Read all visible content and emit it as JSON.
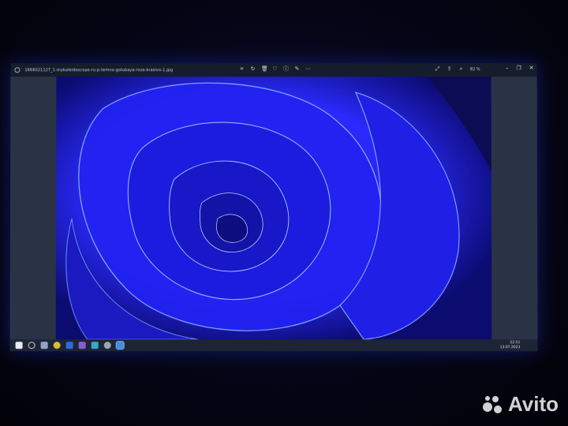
{
  "window": {
    "filename": "1666021127_1-mykaleidoscope-ru-p-temno-golubaya-roza-krasivo-1.jpg",
    "zoom": "82 %",
    "toolbar_icons": [
      "crop-icon",
      "rotate-icon",
      "delete-icon",
      "heart-icon",
      "info-icon",
      "edit-icon",
      "more-icon"
    ],
    "view_icons": [
      "fullscreen-icon",
      "share-icon",
      "zoom-icon"
    ],
    "controls": [
      "minimize-icon",
      "maximize-icon",
      "close-icon"
    ]
  },
  "photo": {
    "subject": "blue rose",
    "colors": {
      "petal": "#2424ff",
      "shadow": "#0a0a66",
      "edge": "#8fb4ff",
      "background": "#1a2438"
    }
  },
  "taskbar": {
    "icons": [
      "start-icon",
      "search-icon",
      "task-view-icon",
      "yandex-browser-icon",
      "word-icon",
      "vk-icon",
      "checkmark-app-icon",
      "settings-icon",
      "photos-icon"
    ],
    "time": "22:51",
    "date": "13.07.2023"
  },
  "watermark": {
    "text": "Avito"
  }
}
